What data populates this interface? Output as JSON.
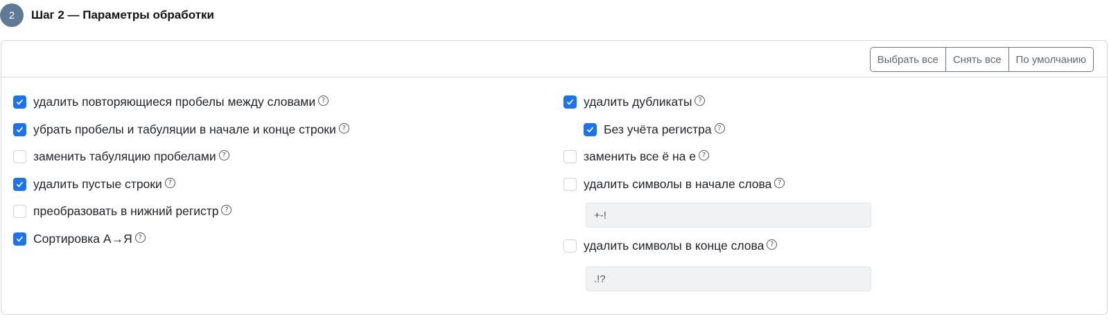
{
  "step": {
    "number": "2",
    "title": "Шаг 2 — Параметры обработки"
  },
  "toolbar": {
    "select_all": "Выбрать все",
    "clear_all": "Снять все",
    "defaults": "По умолчанию"
  },
  "options_left": [
    {
      "label": "удалить повторяющиеся пробелы между словами",
      "checked": true
    },
    {
      "label": "убрать пробелы и табуляции в начале и конце строки",
      "checked": true
    },
    {
      "label": "заменить табуляцию пробелами",
      "checked": false
    },
    {
      "label": "удалить пустые строки",
      "checked": true
    },
    {
      "label": "преобразовать в нижний регистр",
      "checked": false
    },
    {
      "label": "Сортировка А→Я",
      "checked": true
    }
  ],
  "options_right": [
    {
      "label": "удалить дубликаты",
      "checked": true
    },
    {
      "label": "Без учёта регистра",
      "checked": true
    },
    {
      "label": "заменить все ё на е",
      "checked": false
    },
    {
      "label": "удалить символы в начале слова",
      "checked": false,
      "input_value": "+-!"
    },
    {
      "label": "удалить символы в конце слова",
      "checked": false,
      "input_value": ".!?"
    }
  ],
  "help_glyph": "?",
  "colors": {
    "accent": "#1a73f0",
    "badge": "#5f7a95"
  }
}
